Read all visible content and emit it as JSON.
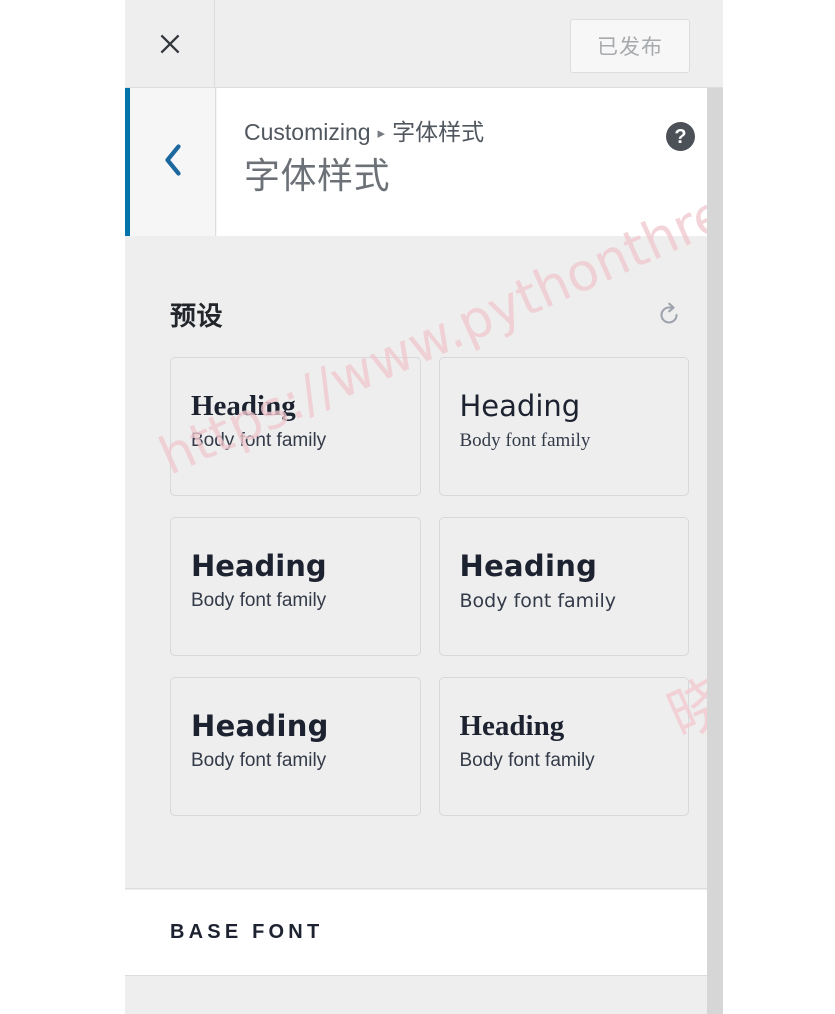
{
  "window": {
    "panel_background": "#eeeeee",
    "accent_color": "#0073aa"
  },
  "topbar": {
    "close_label": "close-icon",
    "publish_label": "已发布"
  },
  "section_header": {
    "back_label": "back-chevron",
    "breadcrumb_root": "Customizing",
    "breadcrumb_separator": "▸",
    "breadcrumb_current": "字体样式",
    "title": "字体样式",
    "help_label": "?"
  },
  "presets": {
    "label": "预设",
    "reset_label": "reset-icon",
    "cards": [
      {
        "heading": "Heading",
        "body": "Body font family",
        "heading_style": "f-serif-bold",
        "body_style": "f-sans-med"
      },
      {
        "heading": "Heading",
        "body": "Body font family",
        "heading_style": "f-sans-light",
        "body_style": "f-serif"
      },
      {
        "heading": "Heading",
        "body": "Body font family",
        "heading_style": "f-sans-bold",
        "body_style": "f-sans-med"
      },
      {
        "heading": "Heading",
        "body": "Body font family",
        "heading_style": "f-sans-heavy",
        "body_style": "f-sans-light"
      },
      {
        "heading": "Heading",
        "body": "Body font family",
        "heading_style": "f-sans-heavy",
        "body_style": "f-sans-med"
      },
      {
        "heading": "Heading",
        "body": "Body font family",
        "heading_style": "f-serif-bold",
        "body_style": "f-sans-med"
      }
    ]
  },
  "base_font": {
    "label": "BASE FONT"
  },
  "watermarks": {
    "url": "https://www.pythonthree.com",
    "chinese": "晓得博客"
  }
}
